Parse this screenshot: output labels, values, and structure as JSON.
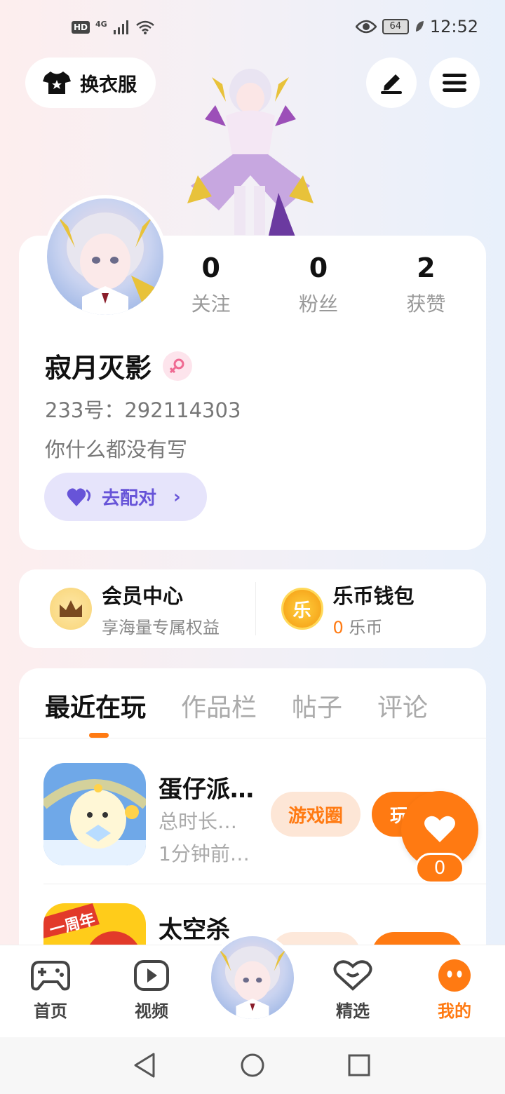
{
  "status_bar": {
    "hd": "HD",
    "network": "4G",
    "battery": "64",
    "time": "12:52"
  },
  "header": {
    "wardrobe_label": "换衣服",
    "edit_icon": "pen-icon",
    "menu_icon": "hamburger-menu-icon"
  },
  "profile": {
    "stats": [
      {
        "value": "0",
        "label": "关注"
      },
      {
        "value": "0",
        "label": "粉丝"
      },
      {
        "value": "2",
        "label": "获赞"
      }
    ],
    "name": "寂月灭影",
    "gender_icon": "female-icon",
    "uid": "233号：292114303",
    "bio": "你什么都没有写",
    "match_label": "去配对"
  },
  "membership": {
    "vip_title": "会员中心",
    "vip_subtitle": "享海量专属权益",
    "wallet_title": "乐币钱包",
    "coin_glyph": "乐",
    "wallet_amount": "0",
    "wallet_unit": "乐币"
  },
  "tabs": [
    "最近在玩",
    "作品栏",
    "帖子",
    "评论"
  ],
  "games": [
    {
      "title": "蛋仔派…",
      "playtime": "总时长…",
      "last_played": "1分钟前…",
      "circle_label": "游戏圈",
      "play_label": "玩"
    },
    {
      "title": "太空杀",
      "icon_badge": "一周年"
    }
  ],
  "like_fab": {
    "count": "0"
  },
  "bottom_nav": [
    {
      "label": "首页",
      "icon": "gamepad-icon"
    },
    {
      "label": "视频",
      "icon": "video-play-icon"
    },
    {
      "label": "精选",
      "icon": "heart-chat-icon"
    },
    {
      "label": "我的",
      "icon": "mine-face-icon"
    }
  ],
  "colors": {
    "accent": "#ff7a12",
    "match": "#6754d8"
  }
}
